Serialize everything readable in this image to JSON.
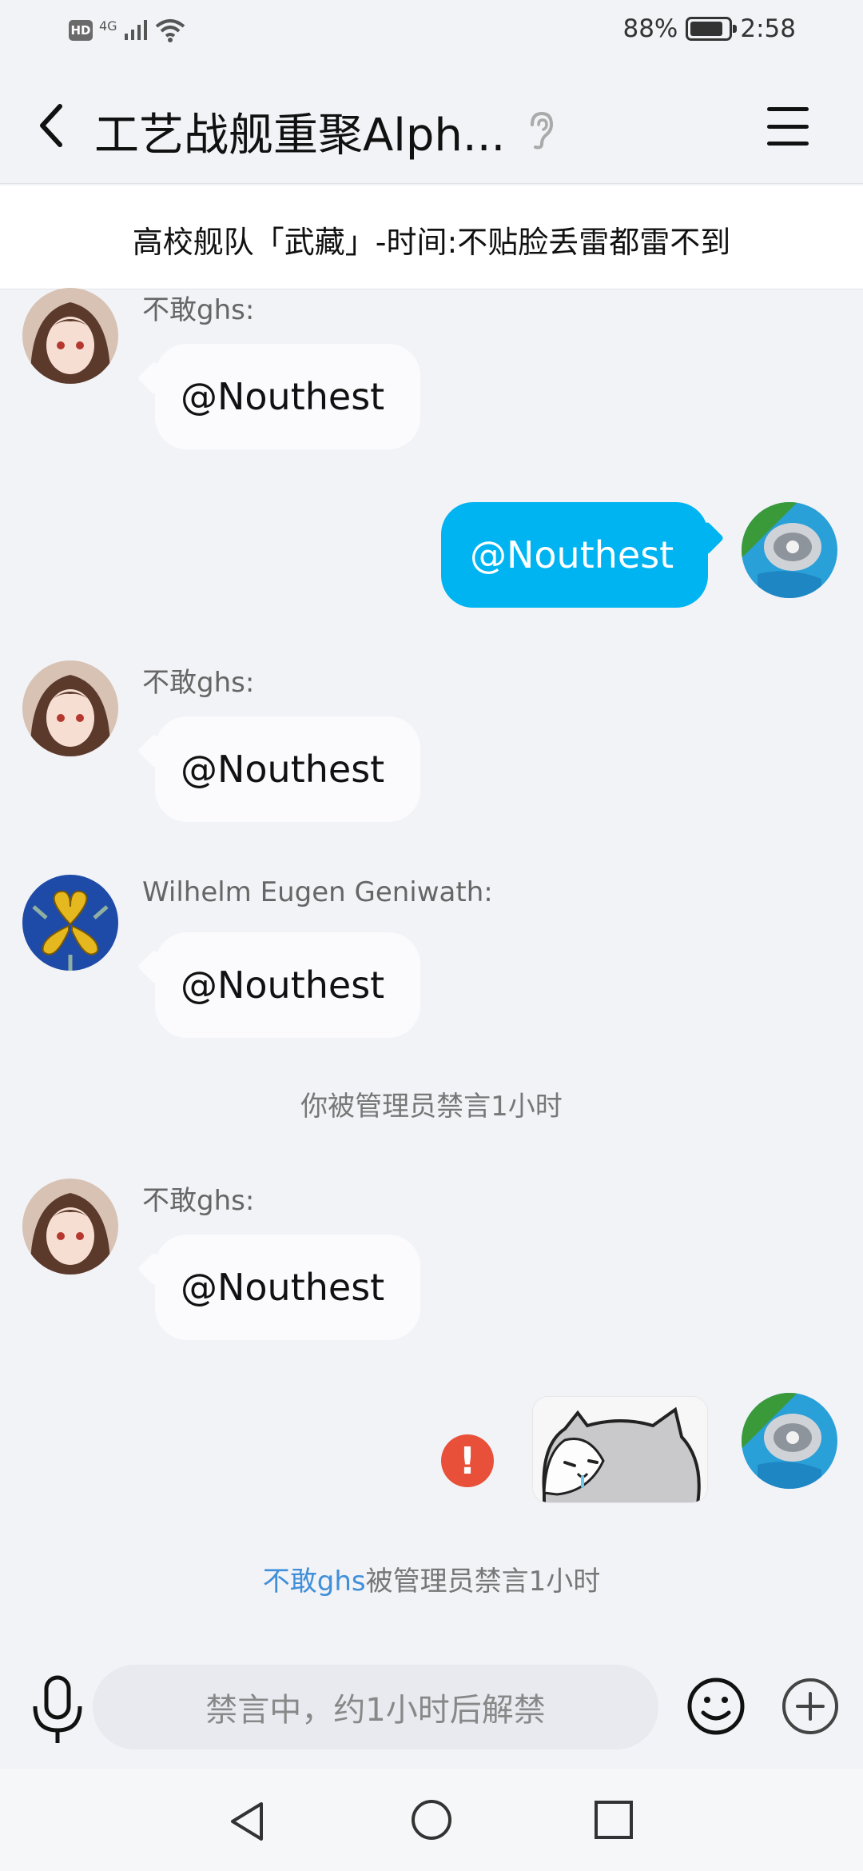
{
  "status_bar": {
    "hd": "HD",
    "network": "4G",
    "battery_percent": "88%",
    "battery_level": 0.88,
    "time": "2:58"
  },
  "header": {
    "title": "工艺战舰重聚Alph...",
    "icons": [
      "back-arrow-icon",
      "ear-icon",
      "menu-icon"
    ]
  },
  "pinned_notice": {
    "text": "高校舰队「武藏」-时间:不贴脸丢雷都雷不到"
  },
  "messages": [
    {
      "type": "incoming",
      "sender": "不敢ghs:",
      "text": "@Nouthest"
    },
    {
      "type": "outgoing",
      "text": "@Nouthest"
    },
    {
      "type": "incoming",
      "sender": "不敢ghs:",
      "text": "@Nouthest"
    },
    {
      "type": "incoming",
      "sender": "Wilhelm Eugen Geniwath:",
      "text": "@Nouthest"
    },
    {
      "type": "system",
      "text": "你被管理员禁言1小时"
    },
    {
      "type": "incoming",
      "sender": "不敢ghs:",
      "text": "@Nouthest"
    },
    {
      "type": "outgoing-sticker",
      "failed_mark": "!"
    },
    {
      "type": "system",
      "highlight": "不敢ghs",
      "text": "被管理员禁言1小时"
    }
  ],
  "input_bar": {
    "placeholder": "禁言中，约1小时后解禁",
    "icons": [
      "mic-icon",
      "emoji-icon",
      "plus-icon"
    ]
  },
  "colors": {
    "accent": "#00b4f2",
    "background": "#f2f3f7",
    "error": "#e8503a",
    "link": "#3f8fd9"
  }
}
